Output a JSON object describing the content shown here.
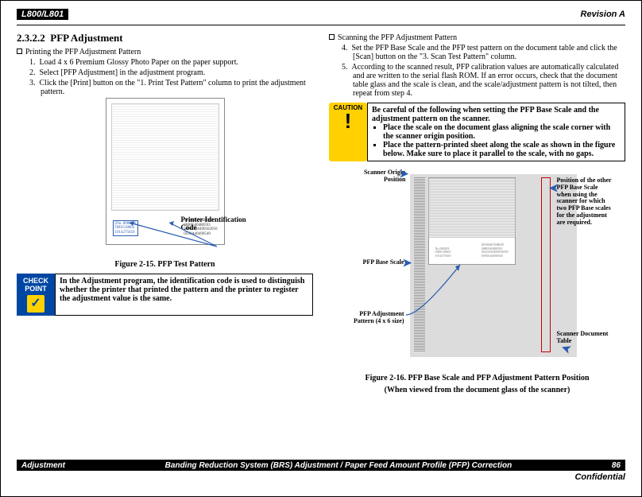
{
  "header": {
    "model": "L800/L801",
    "revision": "Revision A"
  },
  "left": {
    "section_no": "2.3.2.2",
    "section_title": "PFP Adjustment",
    "sub_print": "Printing the PFP Adjustment Pattern",
    "steps": {
      "s1": "Load 4 x 6 Premium Glossy Photo Paper on the paper support.",
      "s2": "Select [PFP Adjustment] in the adjustment program.",
      "s3": "Click the [Print] button on the \"1. Print Test Pattern\" column to print the adjustment pattern."
    },
    "fig1": {
      "caption": "Figure 2-15.  PFP Test Pattern",
      "code_label": "Printer Identification Code",
      "no_label": "(No. 000003)",
      "codes_a": "ORS518803\n1914275650",
      "codes_b": "0650606704B049\n06B0540480593\n06A05A0490502050\n0590A40490540"
    },
    "check": {
      "badge1": "CHECK",
      "badge2": "POINT",
      "text": "In the Adjustment program, the identification code is used to distinguish whether the printer that printed the pattern and the printer to register the adjustment value is the same."
    }
  },
  "right": {
    "sub_scan": "Scanning the PFP Adjustment Pattern",
    "steps": {
      "s4": "Set the PFP Base Scale and the PFP test pattern on the document table and click the [Scan] button on the \"3. Scan Test Pattern\" column.",
      "s5": "According to the scanned result, PFP calibration values are automatically calculated and are written to the serial flash ROM. If an error occurs, check that the document table glass and the scale is clean, and the scale/adjustment pattern is not tilted, then repeat from step 4."
    },
    "caution": {
      "badge": "CAUTION",
      "lead": "Be careful of the following when setting the PFP Base Scale and the adjustment pattern on the scanner.",
      "b1": "Place the scale on the document glass aligning the scale corner with the scanner origin position.",
      "b2": "Place the pattern-printed sheet along the scale as shown in the figure below. Make sure to place it parallel to the scale, with no gaps."
    },
    "fig2": {
      "caption1": "Figure 2-16.  PFP Base Scale and PFP Adjustment Pattern Position",
      "caption2": "(When viewed from the document glass of the scanner)",
      "lbl_origin": "Scanner Origin Position",
      "lbl_base": "PFP Base Scale",
      "lbl_pattern": "PFP Adjustment Pattern (4 x 6 size)",
      "lbl_other": "Position of the other PFP Base Scale when using the scanner for which two PFP Base scales for the adjustment are required.",
      "lbl_table": "Scanner Document Table"
    }
  },
  "footer": {
    "left": "Adjustment",
    "mid": "Banding Reduction System (BRS) Adjustment / Paper Feed Amount Profile (PFP) Correction",
    "page": "86",
    "conf": "Confidential"
  }
}
